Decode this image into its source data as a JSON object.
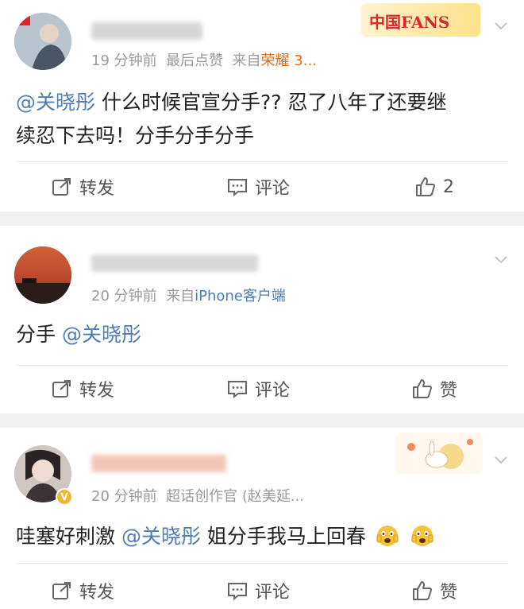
{
  "posts": [
    {
      "meta_time": "19 分钟前",
      "meta_like": "最后点赞",
      "meta_from": "来自",
      "meta_source": "荣耀 3...",
      "badge_text": "中国FANS",
      "content_mention": "@关晓彤",
      "content_text_1": " 什么时候官宣分手?? 忍了八年了还要继",
      "content_text_2": "续忍下去吗！分手分手分手",
      "actions": {
        "repost": "转发",
        "comment": "评论",
        "like": "2"
      }
    },
    {
      "meta_time": "20 分钟前",
      "meta_from": "来自",
      "meta_source": "iPhone客户端",
      "content_pre": "分手 ",
      "content_mention": "@关晓彤",
      "actions": {
        "repost": "转发",
        "comment": "评论",
        "like": "赞"
      }
    },
    {
      "meta_time": "20 分钟前",
      "meta_role": "超话创作官",
      "meta_extra": "(赵美延...",
      "content_pre": "哇塞好刺激 ",
      "content_mention": "@关晓彤",
      "content_post": " 姐分手我马上回春",
      "actions": {
        "repost": "转发",
        "comment": "评论",
        "like": "赞"
      }
    }
  ],
  "colors": {
    "mention": "#4f7cb5",
    "meta": "#9a9a9a",
    "background": "#f0f0f2"
  }
}
